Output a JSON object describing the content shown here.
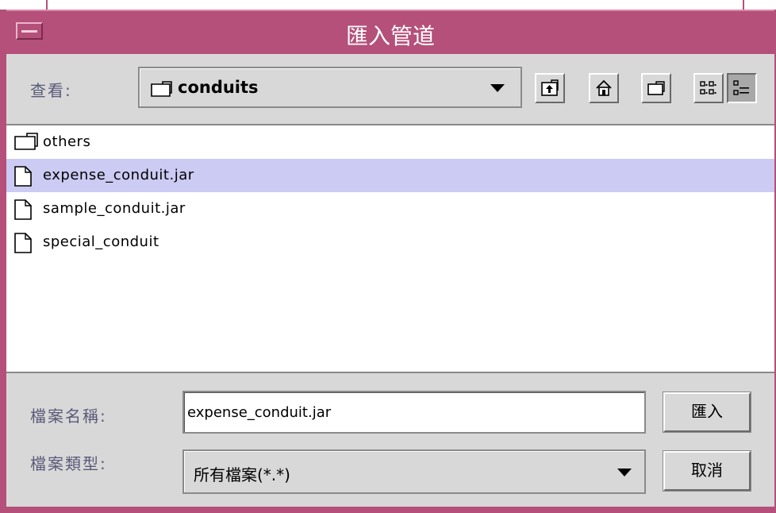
{
  "window": {
    "title": "匯入管道"
  },
  "toolbar": {
    "look_in_label": "查看:",
    "current_folder": "conduits",
    "buttons": [
      {
        "name": "up-one-level",
        "icon": "up-folder-icon"
      },
      {
        "name": "home",
        "icon": "home-icon"
      },
      {
        "name": "new-folder",
        "icon": "new-folder-icon"
      },
      {
        "name": "list-view",
        "icon": "list-view-icon"
      },
      {
        "name": "details-view",
        "icon": "details-view-icon",
        "pressed": true
      }
    ]
  },
  "files": [
    {
      "name": "others",
      "type": "folder",
      "selected": false
    },
    {
      "name": "expense_conduit.jar",
      "type": "file",
      "selected": true
    },
    {
      "name": "sample_conduit.jar",
      "type": "file",
      "selected": false
    },
    {
      "name": "special_conduit",
      "type": "file",
      "selected": false
    }
  ],
  "form": {
    "file_name_label": "檔案名稱:",
    "file_name_value": "expense_conduit.jar",
    "file_type_label": "檔案類型:",
    "file_type_value": "所有檔案(*.*)",
    "import_button": "匯入",
    "cancel_button": "取消"
  },
  "colors": {
    "title_bar": "#b4507a",
    "panel": "#d8d8d8",
    "selection": "#cccbf3",
    "label_text": "#5a5a7a"
  }
}
